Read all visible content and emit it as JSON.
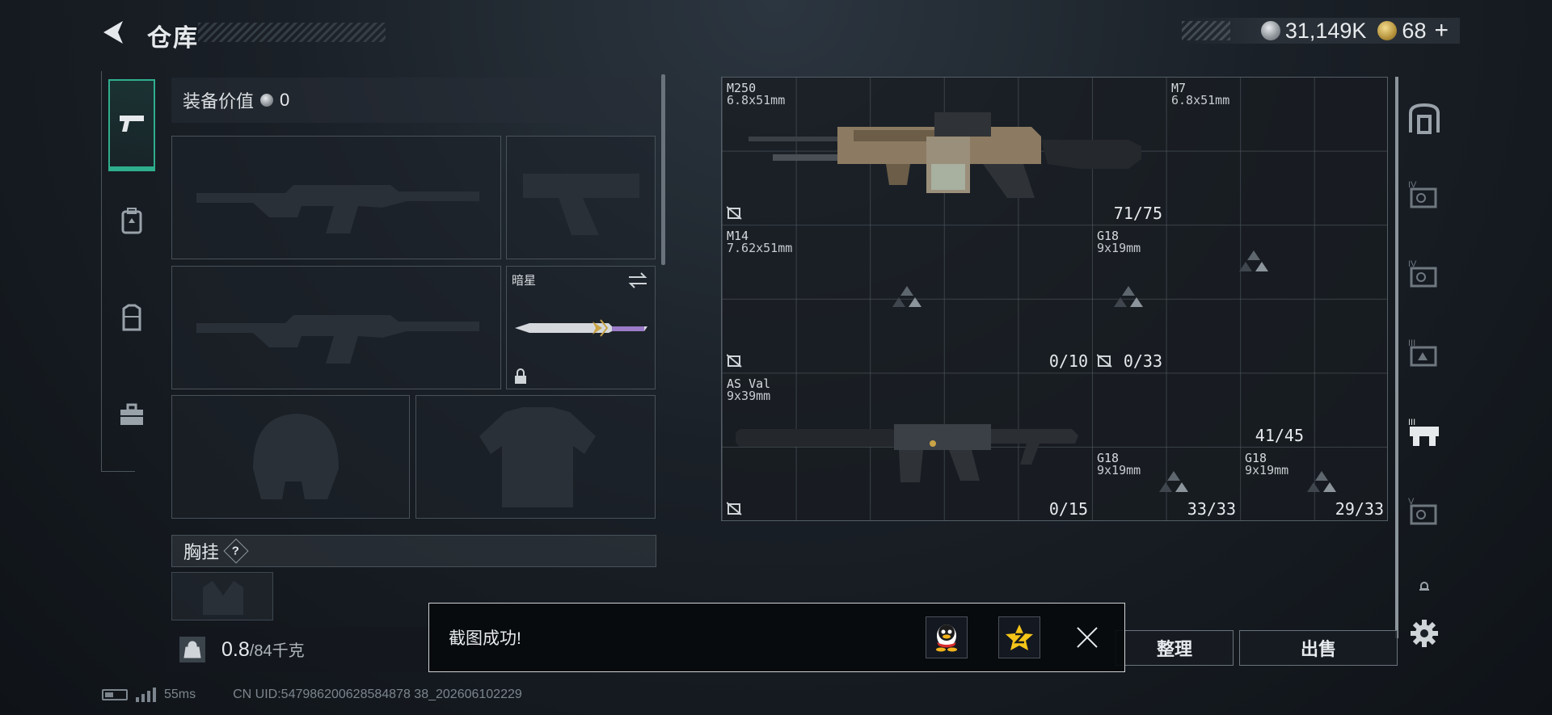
{
  "header": {
    "title": "仓库",
    "silver_amount": "31,149K",
    "gold_amount": "68",
    "add_label": "+"
  },
  "equipment": {
    "value_label": "装备价值",
    "value": "0",
    "melee_name": "暗星",
    "chest_label": "胸挂",
    "help_label": "?",
    "weight_current": "0.8",
    "weight_max": "/84千克",
    "weight_icon_label": "KG"
  },
  "storage": {
    "items": [
      {
        "name": "M250",
        "caliber": "6.8x51mm",
        "ammo": "71/75"
      },
      {
        "name": "M7",
        "caliber": "6.8x51mm",
        "ammo": ""
      },
      {
        "name": "M14",
        "caliber": "7.62x51mm",
        "ammo": "0/10"
      },
      {
        "name": "G18",
        "caliber": "9x19mm",
        "ammo": "0/33"
      },
      {
        "name": "AS Val",
        "caliber": "9x39mm",
        "ammo": "0/15"
      },
      {
        "name": "",
        "caliber": "",
        "ammo": "41/45"
      },
      {
        "name": "G18",
        "caliber": "9x19mm",
        "ammo": "33/33"
      },
      {
        "name": "G18",
        "caliber": "9x19mm",
        "ammo": "29/33"
      }
    ]
  },
  "actions": {
    "sort_label": "整理",
    "sell_label": "出售"
  },
  "toast": {
    "message": "截图成功!"
  },
  "status": {
    "ping": "55ms",
    "uid": "CN UID:547986200628584878 38_202606102229"
  },
  "colors": {
    "accent": "#2fae8d",
    "background": "#1a2027",
    "toast_border": "#cfd4d8"
  },
  "icons": {
    "back": "back-arrow-icon",
    "silver": "silver-coin-icon",
    "gold": "gold-coin-icon",
    "settings": "gear-icon",
    "close": "close-icon"
  }
}
